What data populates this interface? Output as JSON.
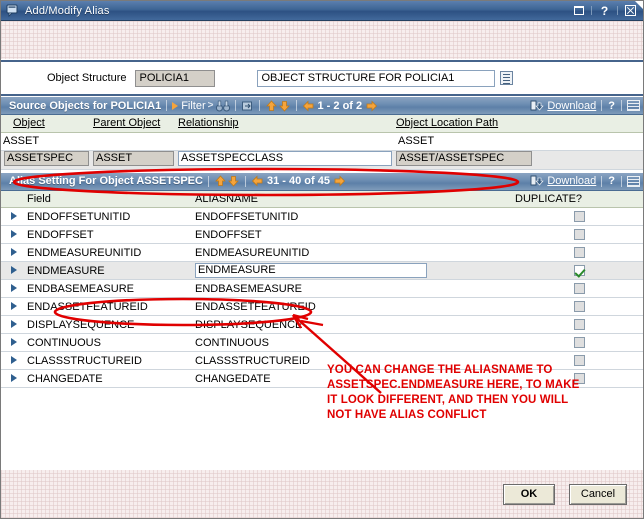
{
  "window": {
    "title": "Add/Modify Alias",
    "icon": "dialog-icon",
    "buttons": {
      "restore": "restore-icon",
      "help": "?",
      "close": "close-icon"
    }
  },
  "object_structure": {
    "label": "Object Structure",
    "value": "POLICIA1",
    "description": "OBJECT STRUCTURE FOR POLICIA1",
    "detail_menu_icon": "detail-menu-icon"
  },
  "source_section": {
    "title": "Source Objects for POLICIA1",
    "filter_label": "Filter",
    "pager": "1 - 2 of 2",
    "download_label": "Download",
    "help_label": "?",
    "icons": {
      "filter": "filter-triangle-icon",
      "search": "binoculars-icon",
      "next_row": "next-row-icon",
      "up": "up-arrow-icon",
      "down": "down-arrow-icon",
      "prev_page": "previous-page-icon",
      "next_page": "next-page-icon",
      "download": "download-icon",
      "grid": "grid-icon"
    },
    "columns": [
      "Object",
      "Parent Object",
      "Relationship",
      "Object Location Path"
    ],
    "rows": [
      {
        "object": "ASSET",
        "parent_object": "",
        "relationship": "",
        "location_path": "ASSET",
        "selected": false,
        "boxed": false
      },
      {
        "object": "ASSETSPEC",
        "parent_object": "ASSET",
        "relationship": "ASSETSPECCLASS",
        "location_path": "ASSET/ASSETSPEC",
        "selected": true,
        "boxed": true
      }
    ]
  },
  "alias_section": {
    "title": "Alias Setting For Object ASSETSPEC",
    "pager": "31 - 40 of 45",
    "download_label": "Download",
    "help_label": "?",
    "icons": {
      "up": "up-arrow-icon",
      "down": "down-arrow-icon",
      "prev_page": "previous-page-icon",
      "next_page": "next-page-icon",
      "download": "download-icon",
      "grid": "grid-icon"
    },
    "columns": [
      "Field",
      "ALIASNAME",
      "DUPLICATE?"
    ],
    "rows": [
      {
        "field": "ENDOFFSETUNITID",
        "aliasname": "ENDOFFSETUNITID",
        "duplicate": false,
        "selected": false,
        "editing": false
      },
      {
        "field": "ENDOFFSET",
        "aliasname": "ENDOFFSET",
        "duplicate": false,
        "selected": false,
        "editing": false
      },
      {
        "field": "ENDMEASUREUNITID",
        "aliasname": "ENDMEASUREUNITID",
        "duplicate": false,
        "selected": false,
        "editing": false
      },
      {
        "field": "ENDMEASURE",
        "aliasname": "ENDMEASURE",
        "duplicate": true,
        "selected": true,
        "editing": true
      },
      {
        "field": "ENDBASEMEASURE",
        "aliasname": "ENDBASEMEASURE",
        "duplicate": false,
        "selected": false,
        "editing": false
      },
      {
        "field": "ENDASSETFEATUREID",
        "aliasname": "ENDASSETFEATUREID",
        "duplicate": false,
        "selected": false,
        "editing": false
      },
      {
        "field": "DISPLAYSEQUENCE",
        "aliasname": "DISPLAYSEQUENCE",
        "duplicate": false,
        "selected": false,
        "editing": false
      },
      {
        "field": "CONTINUOUS",
        "aliasname": "CONTINUOUS",
        "duplicate": false,
        "selected": false,
        "editing": false
      },
      {
        "field": "CLASSSTRUCTUREID",
        "aliasname": "CLASSSTRUCTUREID",
        "duplicate": false,
        "selected": false,
        "editing": false
      },
      {
        "field": "CHANGEDATE",
        "aliasname": "CHANGEDATE",
        "duplicate": false,
        "selected": false,
        "editing": false
      }
    ]
  },
  "footer": {
    "ok_label": "OK",
    "cancel_label": "Cancel"
  },
  "annotation": {
    "color": "#e00000",
    "line1": "YOU CAN CHANGE THE ALIASNAME TO",
    "line2": "ASSETSPEC.ENDMEASURE HERE, TO MAKE",
    "line3": "IT LOOK DIFFERENT, AND THEN YOU WILL",
    "line4": "NOT HAVE ALIAS CONFLICT"
  },
  "colors": {
    "titlebar": "#3d6494",
    "section_bar": "#6f8fb3",
    "accent_orange": "#f5a43c",
    "annotation_red": "#e00000",
    "check_green": "#2a8a2a",
    "header_green": "#e9efe4"
  }
}
